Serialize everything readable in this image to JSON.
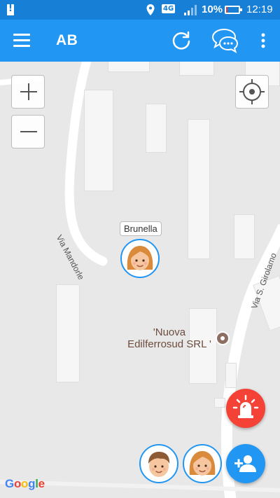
{
  "status_bar": {
    "network_label": "4G",
    "battery_text": "10%",
    "battery_level": 0.1,
    "time": "12:19",
    "colors": {
      "background": "#1780d6",
      "battery_low": "#e53935"
    }
  },
  "app_bar": {
    "title": "AB",
    "color": "#2196f3",
    "icons": [
      "menu-icon",
      "refresh-icon",
      "chat-icon",
      "more-vert-icon"
    ]
  },
  "map": {
    "streets": [
      "Via Mandorle",
      "Via S. Girolamo"
    ],
    "place": {
      "line1": "'Nuova",
      "line2": "Edilferrosud SRL '"
    },
    "attribution": "Google",
    "controls": [
      "zoom-in-icon",
      "zoom-out-icon",
      "my-location-icon"
    ]
  },
  "markers": [
    {
      "name": "Brunella",
      "avatar_icon": "girl-avatar-icon"
    }
  ],
  "contacts_row": [
    {
      "avatar_icon": "boy-avatar-icon"
    },
    {
      "avatar_icon": "girl-avatar-icon"
    }
  ],
  "actions": {
    "sos_icon": "siren-icon",
    "sos_color": "#f44336",
    "add_contact_icon": "add-person-icon",
    "add_contact_color": "#2196f3"
  }
}
